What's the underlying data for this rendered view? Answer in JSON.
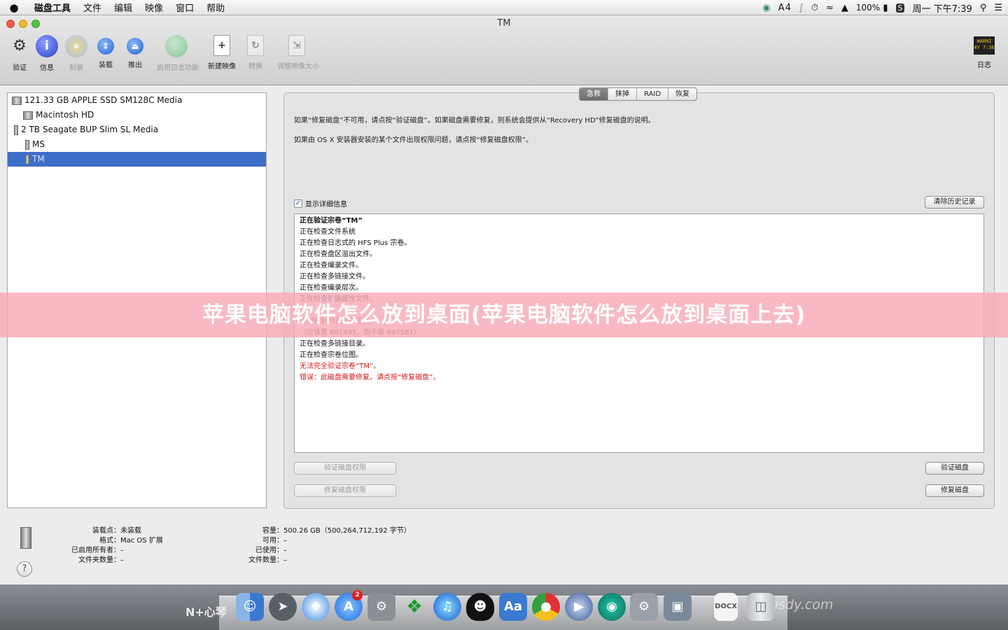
{
  "menubar": {
    "apple": "",
    "items": [
      "磁盘工具",
      "文件",
      "编辑",
      "映像",
      "窗口",
      "帮助"
    ],
    "tray": {
      "input": "4",
      "battery": "100%",
      "clock": "周一 下午7:39"
    }
  },
  "window": {
    "title": "TM"
  },
  "toolbar": {
    "verify": "验证",
    "info": "信息",
    "burn": "刻录",
    "mount": "装载",
    "eject": "推出",
    "journal": "启用日志功能",
    "new_image": "新建映像",
    "convert": "转换",
    "resize": "调整映像大小",
    "log": "日志",
    "log_icon_text": "WARNI\n4Y 7:36"
  },
  "sidebar": {
    "items": [
      "121.33 GB APPLE SSD SM128C Media",
      "Macintosh HD",
      "2 TB Seagate BUP Slim SL Media",
      "MS",
      "TM"
    ]
  },
  "tabs": [
    "急救",
    "抹掉",
    "RAID",
    "恢复"
  ],
  "firstaid": {
    "note1": "如果“修复磁盘”不可用，请点按“验证磁盘”。如果磁盘需要修复，则系统会提供从“Recovery HD”修复磁盘的说明。",
    "note2": "如果由 OS X 安装器安装的某个文件出现权限问题，请点按“修复磁盘权限”。",
    "show_details": "显示详细信息",
    "clear_history": "清除历史记录",
    "log": [
      {
        "t": "正在验证宗卷“TM”",
        "c": "b"
      },
      {
        "t": "正在检查文件系统",
        "c": ""
      },
      {
        "t": "正在检查日志式的 HFS Plus 宗卷。",
        "c": ""
      },
      {
        "t": "正在检查盘区溢出文件。",
        "c": ""
      },
      {
        "t": "正在检查编录文件。",
        "c": ""
      },
      {
        "t": "正在检查多链接文件。",
        "c": ""
      },
      {
        "t": "正在检查编录层次。",
        "c": ""
      },
      {
        "t": "正在检查扩展属性文件。",
        "c": ""
      },
      {
        "t": "",
        "c": ""
      },
      {
        "t": "访问控制列表数不正确",
        "c": "red"
      },
      {
        "t": "（应该是 697495，而不是 697581）",
        "c": ""
      },
      {
        "t": "正在检查多链接目录。",
        "c": ""
      },
      {
        "t": "正在检查宗卷位图。",
        "c": ""
      },
      {
        "t": "无法完全验证宗卷“TM”。",
        "c": "red"
      },
      {
        "t": "错误：此磁盘需要修复。请点按“修复磁盘”。",
        "c": "red"
      }
    ],
    "verify_perms": "验证磁盘权限",
    "repair_perms": "修复磁盘权限",
    "verify_disk": "验证磁盘",
    "repair_disk": "修复磁盘"
  },
  "info": {
    "left": [
      [
        "装载点：",
        "未装载"
      ],
      [
        "格式：",
        "Mac OS 扩展"
      ],
      [
        "已启用所有者：",
        "–"
      ],
      [
        "文件夹数量：",
        "–"
      ]
    ],
    "right": [
      [
        "容量：",
        "500.26 GB（500,264,712,192 字节）"
      ],
      [
        "可用：",
        "–"
      ],
      [
        "已使用：",
        "–"
      ],
      [
        "文件数量：",
        "–"
      ]
    ]
  },
  "help": "?",
  "banner": "苹果电脑软件怎么放到桌面(苹果电脑软件怎么放到桌面上去)",
  "desktop": {
    "wm_left": "N+心琴",
    "wm_right": "usdy.com",
    "badge": "2"
  }
}
